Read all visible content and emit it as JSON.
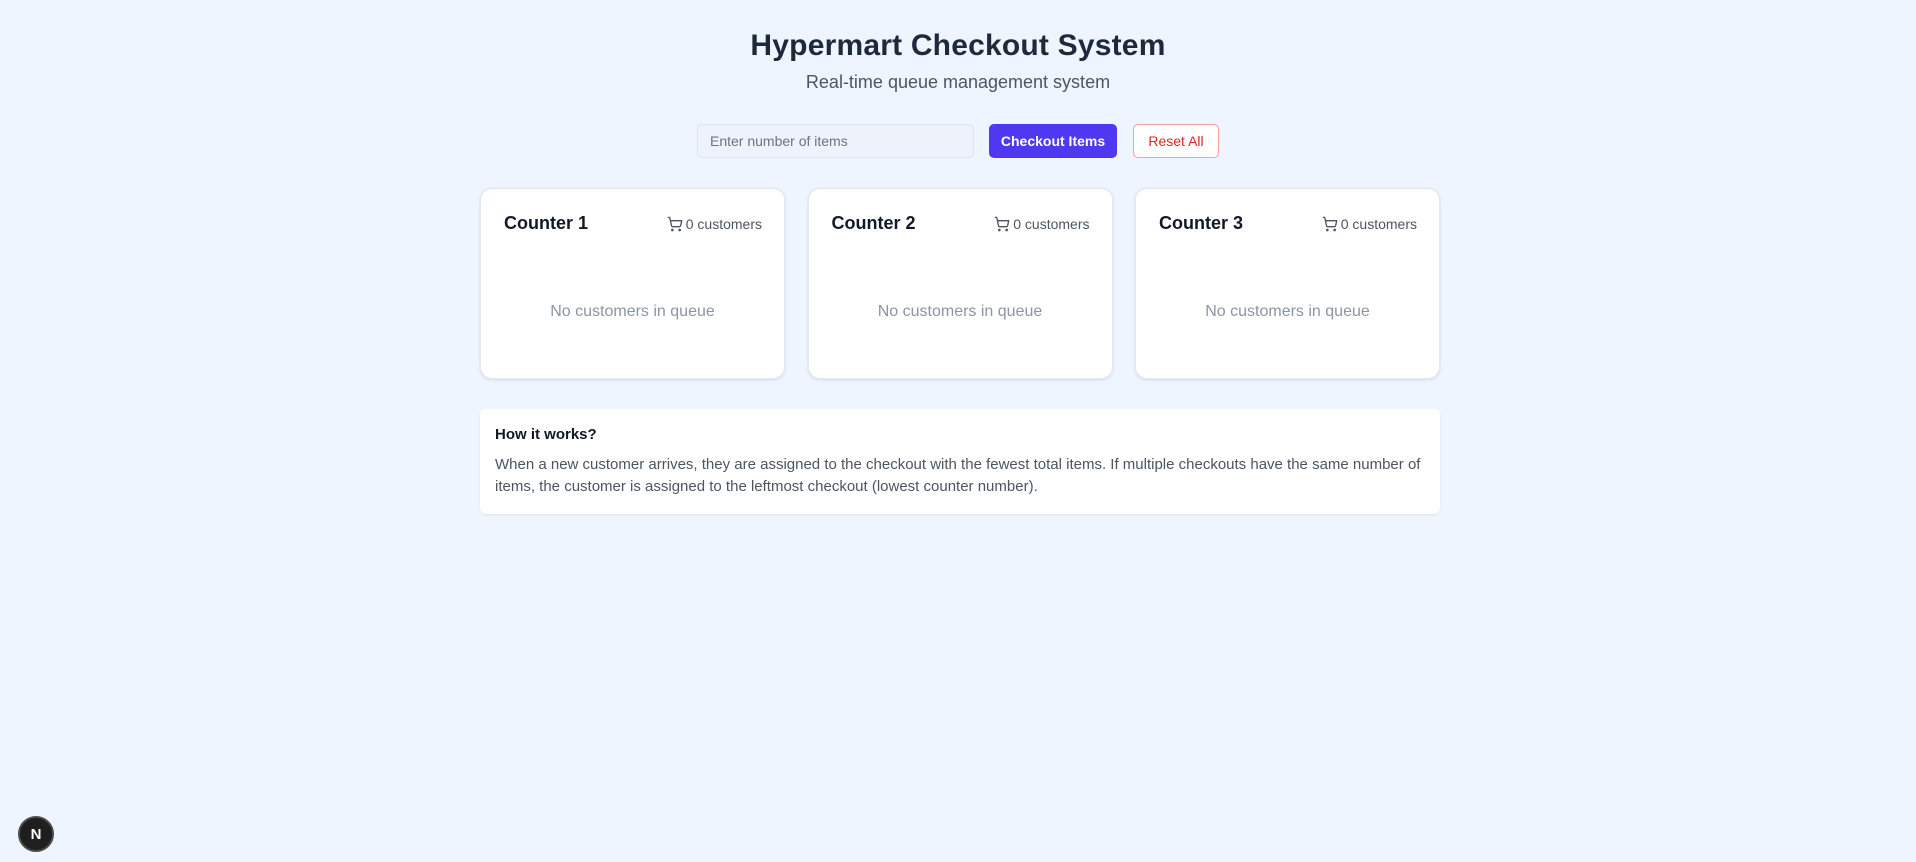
{
  "header": {
    "title": "Hypermart Checkout System",
    "subtitle": "Real-time queue management system"
  },
  "controls": {
    "items_input_placeholder": "Enter number of items",
    "items_input_value": "",
    "checkout_label": "Checkout Items",
    "reset_label": "Reset All"
  },
  "counters": [
    {
      "name": "Counter 1",
      "customers": "0 customers",
      "empty_text": "No customers in queue"
    },
    {
      "name": "Counter 2",
      "customers": "0 customers",
      "empty_text": "No customers in queue"
    },
    {
      "name": "Counter 3",
      "customers": "0 customers",
      "empty_text": "No customers in queue"
    }
  ],
  "info": {
    "title": "How it works?",
    "text": "When a new customer arrives, they are assigned to the checkout with the fewest total items. If multiple checkouts have the same number of items, the customer is assigned to the leftmost checkout (lowest counter number)."
  },
  "icons": {
    "cart": "cart-icon",
    "dev_badge": "nextjs-logo-icon"
  },
  "colors": {
    "accent": "#4f38f0",
    "danger": "#dc2626",
    "background": "#eff5ff"
  },
  "dev_badge": {
    "letter": "N"
  }
}
